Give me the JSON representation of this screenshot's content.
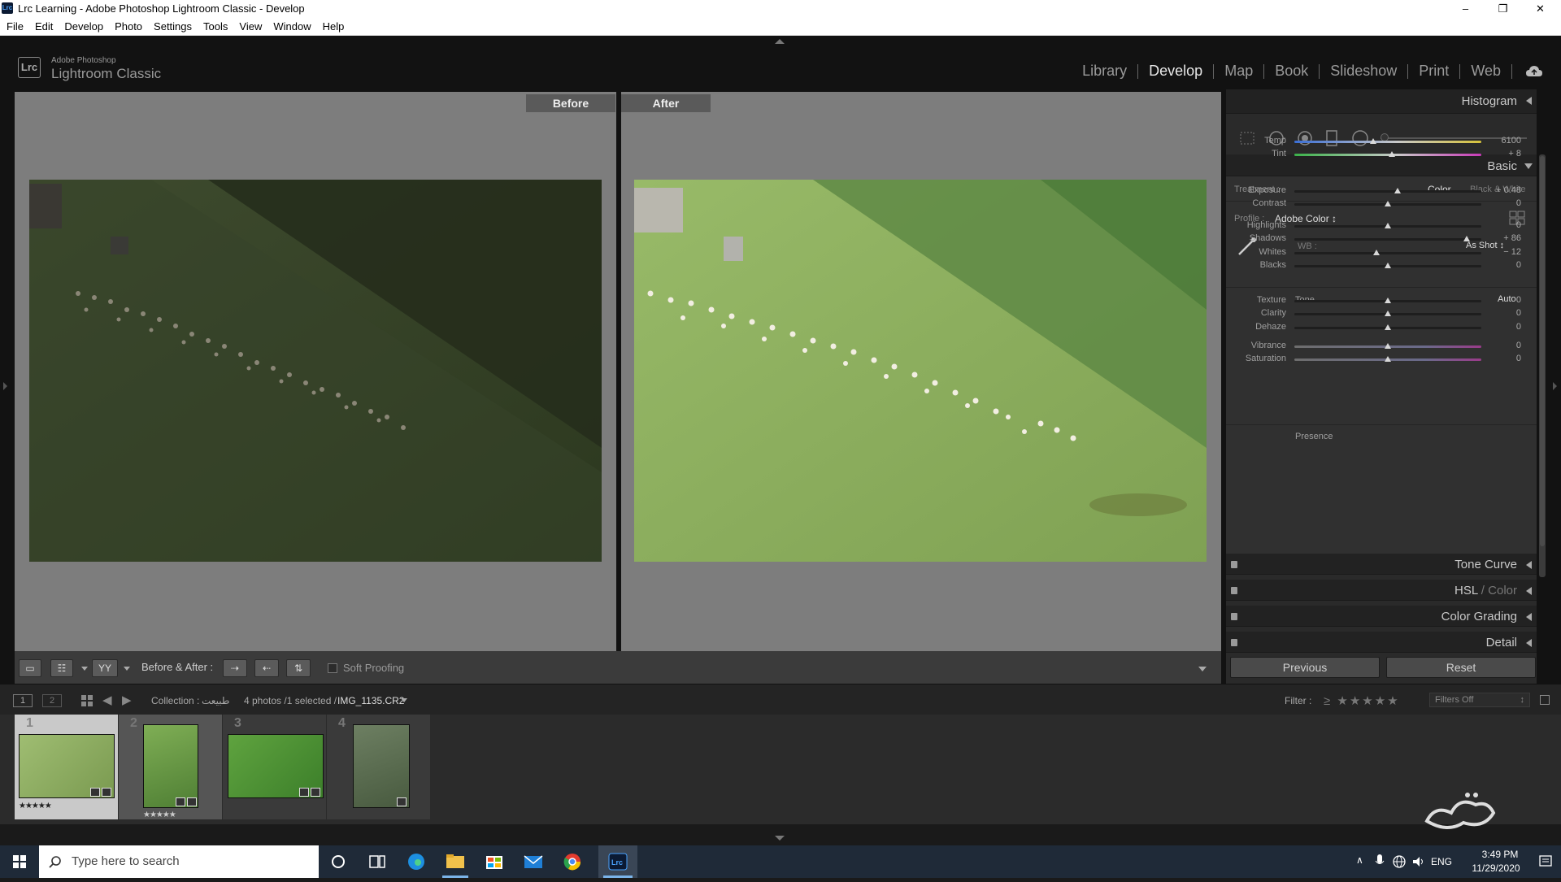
{
  "window": {
    "title": "Lrc Learning - Adobe Photoshop Lightroom Classic - Develop",
    "icon_label": "Lrc"
  },
  "menu": [
    "File",
    "Edit",
    "Develop",
    "Photo",
    "Settings",
    "Tools",
    "View",
    "Window",
    "Help"
  ],
  "brand": {
    "logo": "Lrc",
    "small": "Adobe Photoshop",
    "large": "Lightroom Classic"
  },
  "modules": [
    {
      "label": "Library",
      "active": false
    },
    {
      "label": "Develop",
      "active": true
    },
    {
      "label": "Map",
      "active": false
    },
    {
      "label": "Book",
      "active": false
    },
    {
      "label": "Slideshow",
      "active": false
    },
    {
      "label": "Print",
      "active": false
    },
    {
      "label": "Web",
      "active": false
    }
  ],
  "view": {
    "before_label": "Before",
    "after_label": "After"
  },
  "toolbar": {
    "before_after_label": "Before & After :",
    "yy_label": "YY",
    "soft_proofing_label": "Soft Proofing"
  },
  "panels": {
    "histogram": "Histogram",
    "basic": "Basic",
    "treatment_label": "Treatment :",
    "treatment_color": "Color",
    "treatment_bw": "Black & White",
    "profile_label": "Profile :",
    "profile_value": "Adobe Color",
    "wb_label": "WB :",
    "wb_value": "As Shot",
    "tone_label": "Tone",
    "auto_label": "Auto",
    "presence_label": "Presence",
    "tone_curve": "Tone Curve",
    "hsl_a": "HSL",
    "hsl_sep": " / ",
    "hsl_b": "Color",
    "color_grading": "Color Grading",
    "detail": "Detail",
    "previous_button": "Previous",
    "reset_button": "Reset"
  },
  "sliders": [
    {
      "key": "temp",
      "label": "Temp",
      "value": "6100",
      "pos": 0.42,
      "track": "temp"
    },
    {
      "key": "tint",
      "label": "Tint",
      "value": "+ 8",
      "pos": 0.52,
      "track": "tint"
    },
    {
      "key": "exposure",
      "label": "Exposure",
      "value": "+ 0.48",
      "pos": 0.55,
      "track": "gray"
    },
    {
      "key": "contrast",
      "label": "Contrast",
      "value": "0",
      "pos": 0.5,
      "track": "gray"
    },
    {
      "key": "highlights",
      "label": "Highlights",
      "value": "0",
      "pos": 0.5,
      "track": "gray"
    },
    {
      "key": "shadows",
      "label": "Shadows",
      "value": "+ 86",
      "pos": 0.92,
      "track": "gray"
    },
    {
      "key": "whites",
      "label": "Whites",
      "value": "− 12",
      "pos": 0.44,
      "track": "gray"
    },
    {
      "key": "blacks",
      "label": "Blacks",
      "value": "0",
      "pos": 0.5,
      "track": "gray"
    },
    {
      "key": "texture",
      "label": "Texture",
      "value": "0",
      "pos": 0.5,
      "track": "gray"
    },
    {
      "key": "clarity",
      "label": "Clarity",
      "value": "0",
      "pos": 0.5,
      "track": "gray"
    },
    {
      "key": "dehaze",
      "label": "Dehaze",
      "value": "0",
      "pos": 0.5,
      "track": "gray"
    },
    {
      "key": "vibrance",
      "label": "Vibrance",
      "value": "0",
      "pos": 0.5,
      "track": "vib"
    },
    {
      "key": "saturation",
      "label": "Saturation",
      "value": "0",
      "pos": 0.5,
      "track": "vib"
    }
  ],
  "filmbar": {
    "view1": "1",
    "view2": "2",
    "collection_label": "Collection :",
    "collection_name": "طبیعت",
    "photo_count": "4 photos /1 selected /",
    "filename": "IMG_1135.CR2",
    "filter_label": "Filter :",
    "filter_value": "Filters Off"
  },
  "filmstrip": [
    {
      "num": "1",
      "stars": "★★★★★"
    },
    {
      "num": "2",
      "stars": "★★★★★"
    },
    {
      "num": "3",
      "stars": ""
    },
    {
      "num": "4",
      "stars": ""
    }
  ],
  "taskbar": {
    "search_placeholder": "Type here to search",
    "lang": "ENG",
    "time": "3:49 PM",
    "date": "11/29/2020"
  },
  "colors": {
    "accent_active": "#e8e8e8",
    "grass_after": "#8fb35e",
    "grass_before": "#3a4a2a"
  }
}
